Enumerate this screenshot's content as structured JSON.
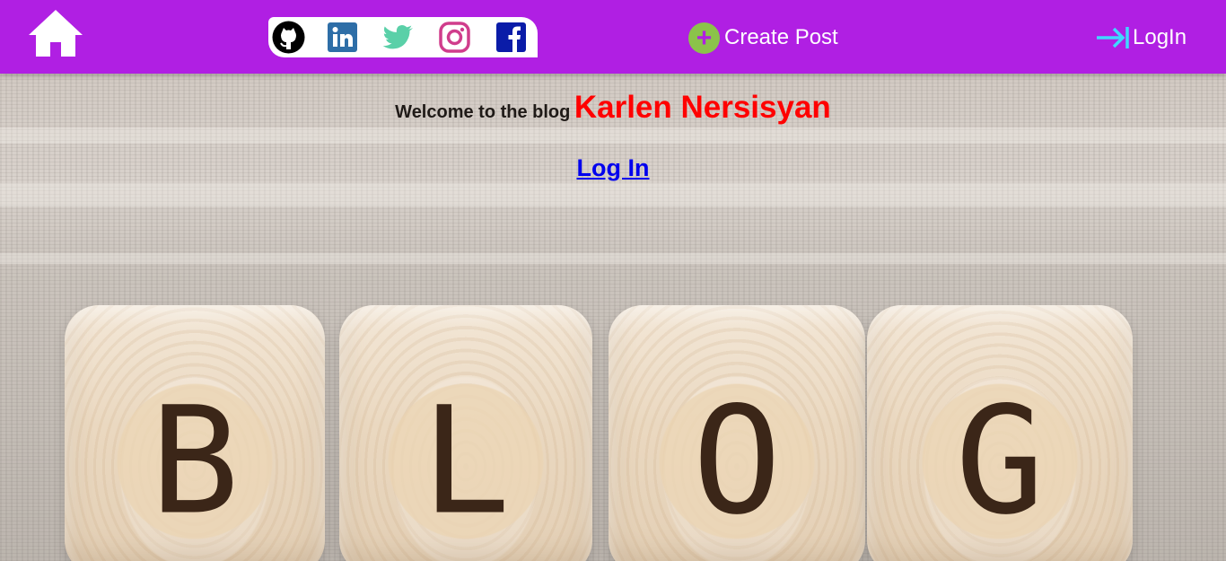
{
  "nav": {
    "home_icon": "home-icon",
    "social_links": [
      {
        "name": "GitHub",
        "icon": "github-icon",
        "color": "#000000"
      },
      {
        "name": "LinkedIn",
        "icon": "linkedin-icon",
        "color": "#2e6ea7"
      },
      {
        "name": "Twitter",
        "icon": "twitter-icon",
        "color": "#5ad0a8"
      },
      {
        "name": "Instagram",
        "icon": "instagram-icon",
        "color": "#d03d8c"
      },
      {
        "name": "Facebook",
        "icon": "facebook-icon",
        "color": "#0a1ca8"
      }
    ],
    "create_post_label": "Create Post",
    "login_label": "LogIn"
  },
  "welcome": {
    "text": "Welcome to the blog",
    "author": "Karlen Nersisyan"
  },
  "login_link": "Log In",
  "hero": {
    "letters": [
      "B",
      "L",
      "O",
      "G"
    ]
  },
  "colors": {
    "navbar": "#b01fe3",
    "create_post_icon": "#8bc34a",
    "login_arrow": "#3fd8ff",
    "author": "#ff0000",
    "link": "#0000ee"
  }
}
